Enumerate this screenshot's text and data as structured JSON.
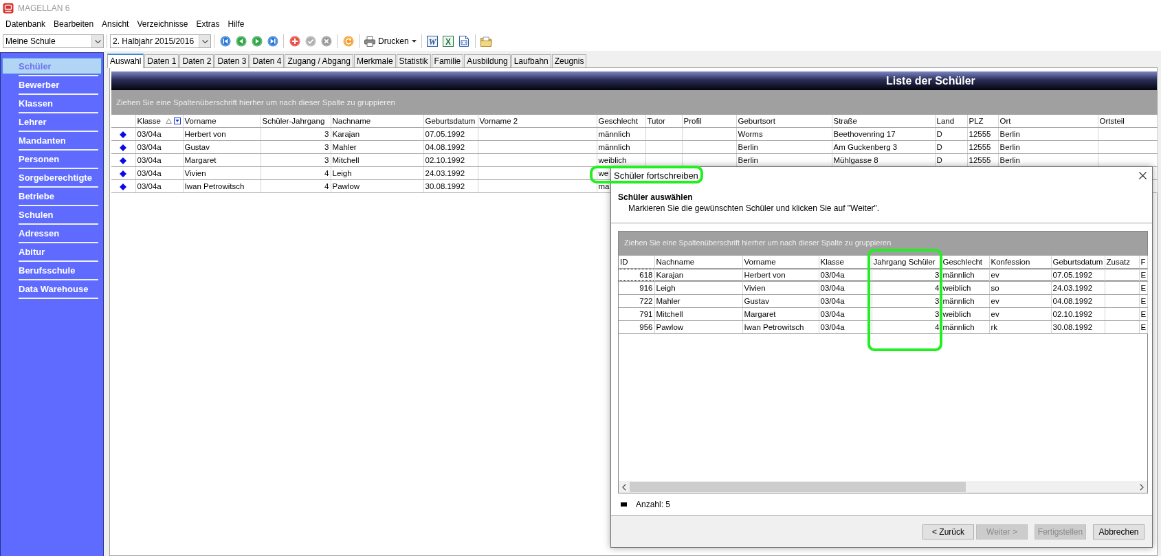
{
  "window": {
    "title": "MAGELLAN 6"
  },
  "menu": [
    "Datenbank",
    "Bearbeiten",
    "Ansicht",
    "Verzeichnisse",
    "Extras",
    "Hilfe"
  ],
  "toolbar": [
    {
      "kind": "select",
      "value": "Meine Schule"
    },
    {
      "kind": "separator"
    },
    {
      "kind": "select",
      "value": "2. Halbjahr 2015/2016"
    },
    {
      "kind": "separator"
    },
    {
      "kind": "first",
      "disabled": false
    },
    {
      "kind": "previous",
      "disabled": false
    },
    {
      "kind": "next",
      "disabled": false
    },
    {
      "kind": "last",
      "disabled": false
    },
    {
      "kind": "separator"
    },
    {
      "kind": "add",
      "disabled": false
    },
    {
      "kind": "confirm",
      "disabled": true
    },
    {
      "kind": "cancel",
      "disabled": true
    },
    {
      "kind": "separator"
    },
    {
      "kind": "refresh",
      "disabled": false
    },
    {
      "kind": "separator"
    },
    {
      "kind": "print",
      "label": "Drucken",
      "disabled": false
    },
    {
      "kind": "separator"
    },
    {
      "kind": "word",
      "glyph": "W",
      "disabled": false
    },
    {
      "kind": "excel",
      "glyph": "X",
      "disabled": false
    },
    {
      "kind": "html",
      "disabled": false
    },
    {
      "kind": "separator"
    },
    {
      "kind": "folder",
      "disabled": false
    }
  ],
  "sidebar": {
    "items": [
      {
        "label": "Schüler",
        "selected": true
      },
      {
        "label": "Bewerber",
        "selected": false
      },
      {
        "label": "Klassen",
        "selected": false
      },
      {
        "label": "Lehrer",
        "selected": false
      },
      {
        "label": "Mandanten",
        "selected": false
      },
      {
        "label": "Personen",
        "selected": false
      },
      {
        "label": "Sorgeberechtigte",
        "selected": false
      },
      {
        "label": "Betriebe",
        "selected": false
      },
      {
        "label": "Schulen",
        "selected": false
      },
      {
        "label": "Adressen",
        "selected": false
      },
      {
        "label": "Abitur",
        "selected": false
      },
      {
        "label": "Berufsschule",
        "selected": false
      },
      {
        "label": "Data Warehouse",
        "selected": false
      }
    ]
  },
  "tabs": [
    {
      "label": "Auswahl",
      "selected": true
    },
    {
      "label": "Daten 1",
      "selected": false
    },
    {
      "label": "Daten 2",
      "selected": false
    },
    {
      "label": "Daten 3",
      "selected": false
    },
    {
      "label": "Daten 4",
      "selected": false
    },
    {
      "label": "Zugang / Abgang",
      "selected": false
    },
    {
      "label": "Merkmale",
      "selected": false
    },
    {
      "label": "Statistik",
      "selected": false
    },
    {
      "label": "Familie",
      "selected": false
    },
    {
      "label": "Ausbildung",
      "selected": false
    },
    {
      "label": "Laufbahn",
      "selected": false
    },
    {
      "label": "Zeugnis",
      "selected": false
    }
  ],
  "student_list": {
    "title": "Liste der Schüler",
    "group_hint": "Ziehen Sie eine Spaltenüberschrift hierher um nach dieser Spalte zu gruppieren",
    "columns": [
      {
        "label": "Klasse",
        "kind": "text",
        "sort_ascending": true,
        "filter_button": true
      },
      {
        "label": "Vorname",
        "kind": "text"
      },
      {
        "label": "Schüler-Jahrgang",
        "kind": "number"
      },
      {
        "label": "Nachname",
        "kind": "text"
      },
      {
        "label": "Geburtsdatum",
        "kind": "text"
      },
      {
        "label": "Vorname 2",
        "kind": "text"
      },
      {
        "label": "Geschlecht",
        "kind": "text"
      },
      {
        "label": "Tutor",
        "kind": "text"
      },
      {
        "label": "Profil",
        "kind": "text"
      },
      {
        "label": "Geburtsort",
        "kind": "text"
      },
      {
        "label": "Straße",
        "kind": "text"
      },
      {
        "label": "Land",
        "kind": "text"
      },
      {
        "label": "PLZ",
        "kind": "text"
      },
      {
        "label": "Ort",
        "kind": "text"
      },
      {
        "label": "Ortsteil",
        "kind": "text"
      }
    ],
    "rows": [
      {
        "cells": [
          "03/04a",
          "Herbert von",
          "3",
          "Karajan",
          "07.05.1992",
          null,
          "männlich",
          null,
          null,
          "Worms",
          "Beethovenring 17",
          "D",
          "12555",
          "Berlin",
          null
        ]
      },
      {
        "cells": [
          "03/04a",
          "Gustav",
          "3",
          "Mahler",
          "04.08.1992",
          null,
          "männlich",
          null,
          null,
          "Berlin",
          "Am Guckenberg 3",
          "D",
          "12555",
          "Berlin",
          null
        ]
      },
      {
        "cells": [
          "03/04a",
          "Margaret",
          "3",
          "Mitchell",
          "02.10.1992",
          null,
          "weiblich",
          null,
          null,
          "Berlin",
          "Mühlgasse 8",
          "D",
          "12555",
          "Berlin",
          null
        ]
      },
      {
        "cells": [
          "03/04a",
          "Vivien",
          "4",
          "Leigh",
          "24.03.1992",
          null,
          "we"
        ]
      },
      {
        "cells": [
          "03/04a",
          "Iwan Petrowitsch",
          "4",
          "Pawlow",
          "30.08.1992",
          null,
          "ma"
        ]
      }
    ]
  },
  "dialog": {
    "title": "Schüler fortschreiben",
    "title_highlighted": true,
    "heading": "Schüler auswählen",
    "instruction": "Markieren Sie die gewünschten Schüler und klicken Sie auf \"Weiter\".",
    "group_hint": "Ziehen Sie eine Spaltenüberschrift hierher um nach dieser Spalte zu gruppieren",
    "columns": [
      {
        "label": "ID",
        "kind": "number",
        "highlighted": false
      },
      {
        "label": "Nachname",
        "kind": "text",
        "highlighted": false
      },
      {
        "label": "Vorname",
        "kind": "text",
        "highlighted": false
      },
      {
        "label": "Klasse",
        "kind": "text",
        "highlighted": false
      },
      {
        "label": "Jahrgang Schüler",
        "kind": "number",
        "highlighted": true
      },
      {
        "label": "Geschlecht",
        "kind": "text",
        "highlighted": false
      },
      {
        "label": "Konfession",
        "kind": "text",
        "highlighted": false
      },
      {
        "label": "Geburtsdatum",
        "kind": "text",
        "highlighted": false
      },
      {
        "label": "Zusatz",
        "kind": "text",
        "highlighted": false
      },
      {
        "label": "F",
        "kind": "text",
        "highlighted": false
      }
    ],
    "rows": [
      {
        "focused": true,
        "cells": [
          "618",
          "Karajan",
          "Herbert von",
          "03/04a",
          "3",
          "männlich",
          "ev",
          "07.05.1992",
          null,
          "E"
        ]
      },
      {
        "focused": false,
        "cells": [
          "916",
          "Leigh",
          "Vivien",
          "03/04a",
          "4",
          "weiblich",
          "so",
          "24.03.1992",
          null,
          "E"
        ]
      },
      {
        "focused": false,
        "cells": [
          "722",
          "Mahler",
          "Gustav",
          "03/04a",
          "3",
          "männlich",
          "ev",
          "04.08.1992",
          null,
          "E"
        ]
      },
      {
        "focused": false,
        "cells": [
          "791",
          "Mitchell",
          "Margaret",
          "03/04a",
          "3",
          "weiblich",
          "ev",
          "02.10.1992",
          null,
          "E"
        ]
      },
      {
        "focused": false,
        "cells": [
          "956",
          "Pawlow",
          "Iwan Petrowitsch",
          "03/04a",
          "4",
          "männlich",
          "rk",
          "30.08.1992",
          null,
          "E"
        ]
      }
    ],
    "count_label": "Anzahl: 5",
    "buttons": [
      {
        "label": "< Zurück",
        "disabled": false
      },
      {
        "label": "Weiter >",
        "disabled": true
      },
      {
        "label": "Fertigstellen",
        "disabled": true
      },
      {
        "label": "Abbrechen",
        "disabled": false
      }
    ]
  }
}
